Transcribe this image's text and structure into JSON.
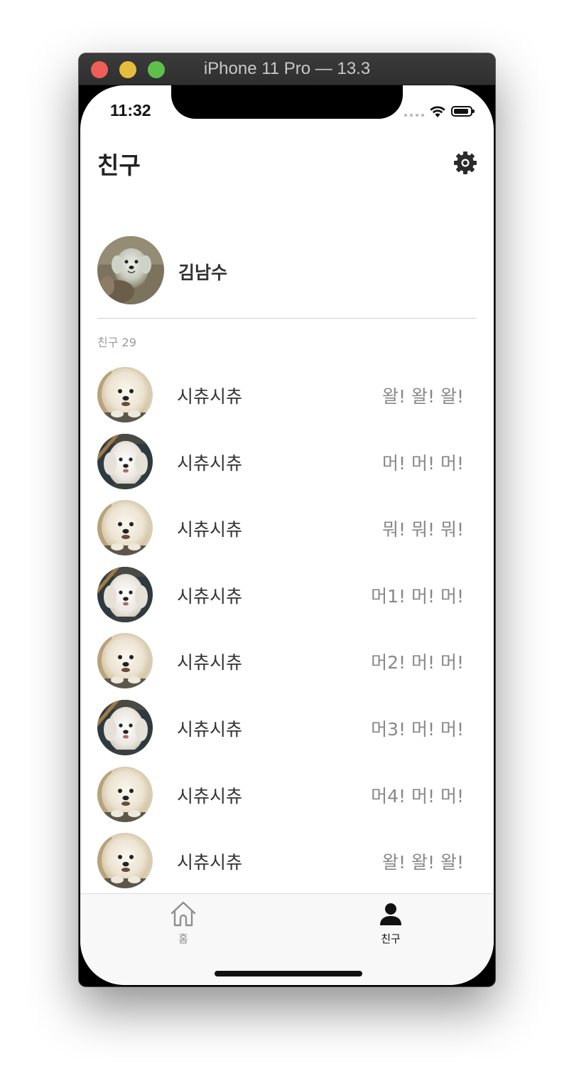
{
  "window": {
    "title": "iPhone 11 Pro — 13.3"
  },
  "status_bar": {
    "time": "11:32"
  },
  "header": {
    "title": "친구",
    "settings_icon": "gear-icon"
  },
  "profile": {
    "name": "김남수"
  },
  "friends_section": {
    "count_label": "친구 29"
  },
  "friends": [
    {
      "name": "시츄시츄",
      "status": "왈! 왈! 왈!",
      "photo": "puppy-a"
    },
    {
      "name": "시츄시츄",
      "status": "머! 머! 머!",
      "photo": "puppy-b"
    },
    {
      "name": "시츄시츄",
      "status": "뭐! 뭐! 뭐!",
      "photo": "puppy-a"
    },
    {
      "name": "시츄시츄",
      "status": "머1! 머! 머!",
      "photo": "puppy-b"
    },
    {
      "name": "시츄시츄",
      "status": "머2! 머! 머!",
      "photo": "puppy-a"
    },
    {
      "name": "시츄시츄",
      "status": "머3! 머! 머!",
      "photo": "puppy-b"
    },
    {
      "name": "시츄시츄",
      "status": "머4! 머! 머!",
      "photo": "puppy-a"
    },
    {
      "name": "시츄시츄",
      "status": "왈! 왈! 왈!",
      "photo": "puppy-a"
    }
  ],
  "tab_bar": {
    "tabs": [
      {
        "label": "홈",
        "icon": "home-icon",
        "selected": false
      },
      {
        "label": "친구",
        "icon": "person-icon",
        "selected": true
      }
    ]
  },
  "colors": {
    "text_primary": "#222222",
    "text_secondary": "#888888",
    "selected_tab": "#111111",
    "unselected_tab": "#8e8e8e"
  }
}
